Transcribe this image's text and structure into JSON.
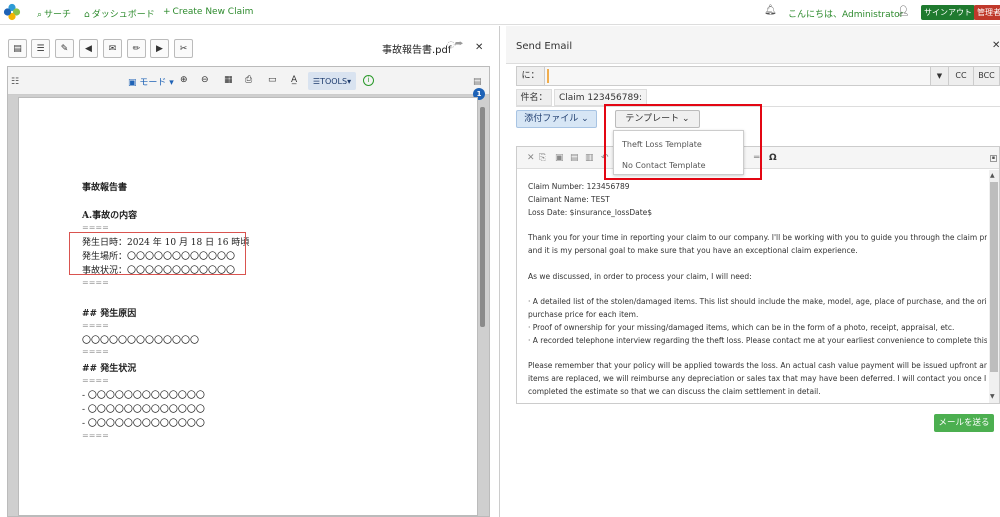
{
  "topnav": {
    "search": "サーチ",
    "dashboard": "ダッシュボード",
    "create_claim": "Create New Claim",
    "greeting": "こんにちは、Administrator",
    "signout": "サインアウト",
    "admin": "管理者"
  },
  "viewer": {
    "filename": "事故報告書.pdf",
    "mode_label": "モード",
    "tools_label": "TOOLS",
    "page_badge": "1",
    "document": {
      "title": "事故報告書",
      "section_a": "A.事故の内容",
      "sep": "====",
      "occurred_at": "発生日時：2024 年 10 月 18 日 16 時頃",
      "place": "発生場所：〇〇〇〇〇〇〇〇〇〇〇〇",
      "status": "事故状況：〇〇〇〇〇〇〇〇〇〇〇〇",
      "cause_heading": "## 発生原因",
      "cause_body": "〇〇〇〇〇〇〇〇〇〇〇〇〇",
      "situation_heading": "## 発生状況",
      "bullet1": "- 〇〇〇〇〇〇〇〇〇〇〇〇〇",
      "bullet2": "- 〇〇〇〇〇〇〇〇〇〇〇〇〇",
      "bullet3": "- 〇〇〇〇〇〇〇〇〇〇〇〇〇"
    }
  },
  "email": {
    "title": "Send Email",
    "to_label": "に：",
    "cc": "CC",
    "bcc": "BCC",
    "subject_label": "件名：",
    "subject_value": "Claim 123456789:",
    "attach_label": "添付ファイル",
    "template_label": "テンプレート",
    "templates": [
      "Theft Loss Template",
      "No Contact Template"
    ],
    "body": [
      "Claim Number: 123456789",
      "Claimant Name: TEST",
      "Loss Date: $insurance_lossDate$",
      "",
      "Thank you for your time in reporting your claim to our company. I'll be working with you to guide you through the claim process",
      "and it is my personal goal to make sure that you have an exceptional claim experience.",
      "",
      "As we discussed, in order to process your claim, I will need:",
      "",
      "· A detailed list of the stolen/damaged items. This list should include the make, model, age, place of purchase, and the original",
      "purchase price for each item.",
      "· Proof of ownership for your missing/damaged items, which can be in the form of a photo, receipt, appraisal, etc.",
      "· A recorded telephone interview regarding the theft loss. Please contact me at your earliest convenience to complete this.",
      "",
      "Please remember that your policy will be applied towards the loss. An actual cash value payment will be issued upfront and as",
      "items are replaced, we will reimburse any depreciation or sales tax that may have been deferred. I will contact you once I have",
      "completed the estimate so that we can discuss the claim settlement in detail."
    ],
    "send_label": "メールを送る"
  }
}
